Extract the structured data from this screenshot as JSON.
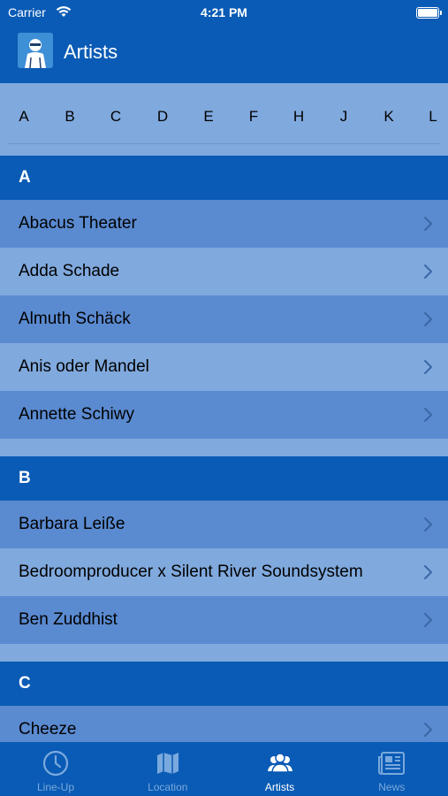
{
  "status_bar": {
    "carrier": "Carrier",
    "time": "4:21 PM"
  },
  "nav": {
    "title": "Artists"
  },
  "index": {
    "letters": [
      "A",
      "B",
      "C",
      "D",
      "E",
      "F",
      "H",
      "J",
      "K",
      "L"
    ]
  },
  "sections": [
    {
      "header": "A",
      "items": [
        "Abacus Theater",
        "Adda Schade",
        "Almuth Schäck",
        "Anis oder Mandel",
        "Annette Schiwy"
      ]
    },
    {
      "header": "B",
      "items": [
        "Barbara Leiße",
        "Bedroomproducer x Silent River Soundsystem",
        "Ben Zuddhist"
      ]
    },
    {
      "header": "C",
      "items": [
        "Cheeze"
      ]
    }
  ],
  "tabs": [
    {
      "label": "Line-Up",
      "icon": "clock-icon",
      "active": false
    },
    {
      "label": "Location",
      "icon": "map-icon",
      "active": false
    },
    {
      "label": "Artists",
      "icon": "people-icon",
      "active": true
    },
    {
      "label": "News",
      "icon": "newspaper-icon",
      "active": false
    }
  ],
  "colors": {
    "primary": "#0a5bb5",
    "row_dark": "#5a8ad0",
    "row_light": "#80a9dd",
    "tab_inactive": "#7aa9dd",
    "tab_active": "#ffffff"
  }
}
